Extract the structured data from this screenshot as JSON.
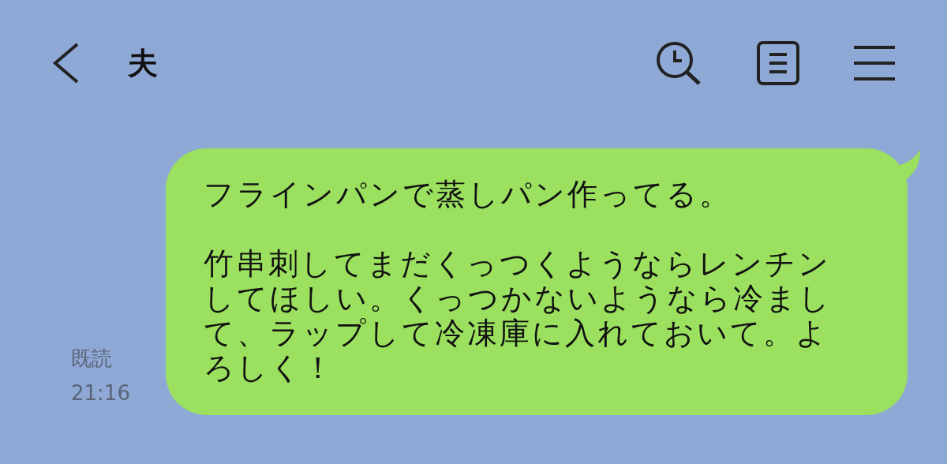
{
  "header": {
    "title": "夫"
  },
  "message": {
    "paragraphs": [
      "フラインパンで蒸しパン作ってる。",
      "竹串刺してまだくっつくようならレンチンしてほしい。くっつかないようなら冷まして、ラップして冷凍庫に入れておいて。よろしく！"
    ],
    "read_label": "既読",
    "time": "21:16"
  }
}
